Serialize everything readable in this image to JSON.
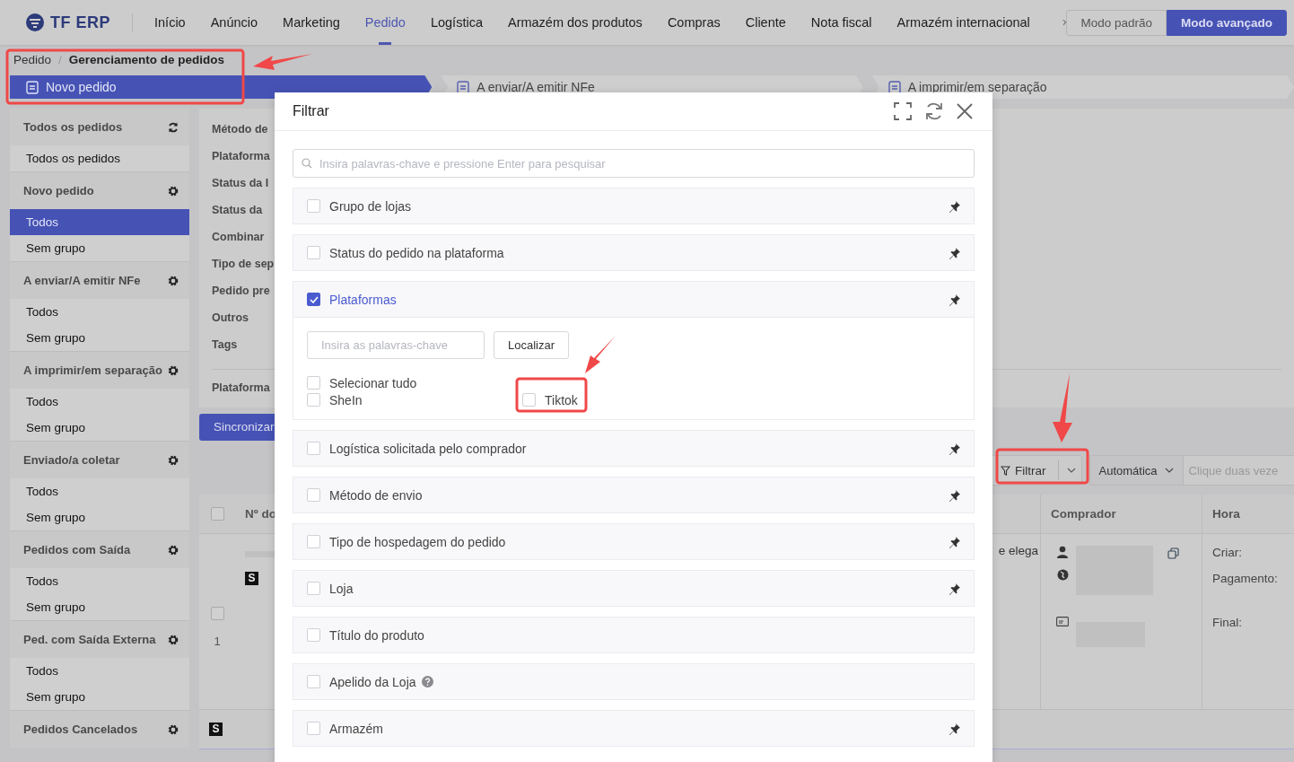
{
  "header": {
    "logo": "TF ERP",
    "nav": [
      {
        "label": "Início",
        "selected": false
      },
      {
        "label": "Anúncio",
        "selected": false
      },
      {
        "label": "Marketing",
        "selected": false
      },
      {
        "label": "Pedido",
        "selected": true
      },
      {
        "label": "Logística",
        "selected": false
      },
      {
        "label": "Armazém dos produtos",
        "selected": false
      },
      {
        "label": "Compras",
        "selected": false
      },
      {
        "label": "Cliente",
        "selected": false
      },
      {
        "label": "Nota fiscal",
        "selected": false
      },
      {
        "label": "Armazém internacional",
        "selected": false
      }
    ],
    "mode_buttons": [
      {
        "label": "Modo padrão",
        "selected": false
      },
      {
        "label": "Modo avançado",
        "selected": true
      }
    ]
  },
  "breadcrumb": [
    "Pedido",
    "Gerenciamento de pedidos"
  ],
  "breadcrumb_separator": "/",
  "status_tabs": [
    {
      "label": "Novo pedido",
      "selected": true
    },
    {
      "label": "A enviar/A emitir NFe",
      "selected": false
    },
    {
      "label": "A imprimir/em separação",
      "selected": false
    }
  ],
  "sidebar": [
    {
      "title": "Todos os pedidos",
      "kind": "refresh",
      "items": [
        {
          "label": "Todos os pedidos",
          "selected": false
        }
      ]
    },
    {
      "title": "Novo pedido",
      "kind": "settings",
      "items": [
        {
          "label": "Todos",
          "selected": true
        },
        {
          "label": "Sem grupo",
          "selected": false
        }
      ]
    },
    {
      "title": "A enviar/A emitir NFe",
      "kind": "settings",
      "items": [
        {
          "label": "Todos",
          "selected": false
        },
        {
          "label": "Sem grupo",
          "selected": false
        }
      ]
    },
    {
      "title": "A imprimir/em separação",
      "kind": "settings",
      "items": [
        {
          "label": "Todos",
          "selected": false
        },
        {
          "label": "Sem grupo",
          "selected": false
        }
      ]
    },
    {
      "title": "Enviado/a coletar",
      "kind": "settings",
      "items": [
        {
          "label": "Todos",
          "selected": false
        },
        {
          "label": "Sem grupo",
          "selected": false
        }
      ]
    },
    {
      "title": "Pedidos com Saída",
      "kind": "settings",
      "items": [
        {
          "label": "Todos",
          "selected": false
        },
        {
          "label": "Sem grupo",
          "selected": false
        }
      ]
    },
    {
      "title": "Ped. com Saída Externa",
      "kind": "settings",
      "items": [
        {
          "label": "Todos",
          "selected": false
        },
        {
          "label": "Sem grupo",
          "selected": false
        }
      ]
    },
    {
      "title": "Pedidos Cancelados",
      "kind": "settings"
    }
  ],
  "filter_labels": [
    "Método de",
    "Plataforma",
    "Status da I",
    "Status da",
    "Combinar",
    "Tipo de sep",
    "Pedido pre",
    "Outros",
    "Tags"
  ],
  "filter_label_extra": "Plataforma",
  "sync_button": "Sincronizar",
  "toolbar": {
    "filter_button": "Filtrar",
    "sort_select": "Automática",
    "search_placeholder": "Clique duas veze"
  },
  "table": {
    "columns": [
      "Nº do",
      "Comprador",
      "Hora"
    ],
    "select_all_checked": false,
    "rows": [
      {
        "checked": false,
        "index": "1",
        "badge": "S",
        "column_3": "e elega",
        "times": [
          "Criar:",
          "Pagamento:",
          "Final:"
        ]
      }
    ],
    "group_badge": "S"
  },
  "modal": {
    "title": "Filtrar",
    "search_placeholder": "Insira palavras-chave e pressione Enter para pesquisar",
    "groups": [
      {
        "label": "Grupo de lojas",
        "checked": false,
        "pinned": true,
        "help": false,
        "expanded": false
      },
      {
        "label": "Status do pedido na plataforma",
        "checked": false,
        "pinned": true,
        "help": false,
        "expanded": false
      },
      {
        "label": "Plataformas",
        "checked": true,
        "pinned": true,
        "help": false,
        "expanded": true
      },
      {
        "label": "Logística solicitada pelo comprador",
        "checked": false,
        "pinned": true,
        "help": false,
        "expanded": false
      },
      {
        "label": "Método de envio",
        "checked": false,
        "pinned": true,
        "help": false,
        "expanded": false
      },
      {
        "label": "Tipo de hospedagem do pedido",
        "checked": false,
        "pinned": true,
        "help": false,
        "expanded": false
      },
      {
        "label": "Loja",
        "checked": false,
        "pinned": true,
        "help": false,
        "expanded": false
      },
      {
        "label": "Título do produto",
        "checked": false,
        "pinned": false,
        "help": false,
        "expanded": false
      },
      {
        "label": "Apelido da Loja",
        "checked": false,
        "pinned": false,
        "help": true,
        "expanded": false
      },
      {
        "label": "Armazém",
        "checked": false,
        "pinned": true,
        "help": false,
        "expanded": false
      }
    ],
    "expanded_content": {
      "keyword_placeholder": "Insira as palavras-chave",
      "find_button": "Localizar",
      "options": [
        {
          "label": "Selecionar tudo",
          "checked": false
        },
        {
          "label": "SheIn",
          "checked": false
        },
        {
          "label": "Tiktok",
          "checked": false
        }
      ]
    }
  }
}
